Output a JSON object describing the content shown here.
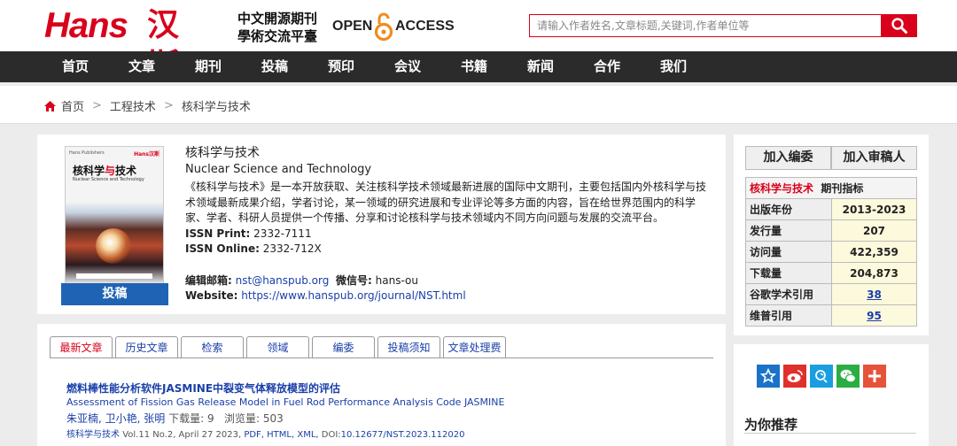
{
  "header": {
    "logo_en": "Hans",
    "logo_cn": "汉斯",
    "tagline_1": "中文開源期刊",
    "tagline_2": "學術交流平臺",
    "oa_open": "OPEN",
    "oa_access": "ACCESS",
    "search_placeholder": "请输入作者姓名,文章标题,关键词,作者单位等"
  },
  "nav": [
    "首页",
    "文章",
    "期刊",
    "投稿",
    "预印",
    "会议",
    "书籍",
    "新闻",
    "合作",
    "我们"
  ],
  "breadcrumb": [
    "首页",
    "工程技术",
    "核科学与技术"
  ],
  "journal": {
    "cover_brand": "Hans Publishers",
    "cover_logo": "Hans汉斯",
    "cover_title_a": "核科学",
    "cover_title_b": "与",
    "cover_title_c": "技术",
    "cover_subtitle": "Nuclear Science and Technology",
    "title_cn": "核科学与技术",
    "title_en": "Nuclear Science and Technology",
    "description": "《核科学与技术》是一本开放获取、关注核科学技术领域最新进展的国际中文期刊，主要包括国内外核科学与技术领域最新成果介绍，学者讨论，某一领域的研究进展和专业评论等多方面的内容，旨在给世界范围内的科学家、学者、科研人员提供一个传播、分享和讨论核科学与技术领域内不同方向问题与发展的交流平台。",
    "issn_print_label": "ISSN Print:",
    "issn_print": "2332-7111",
    "issn_online_label": "ISSN Online:",
    "issn_online": "2332-712X",
    "email_label": "编辑邮箱:",
    "email": "nst@hanspub.org",
    "wechat_label": "微信号:",
    "wechat": "hans-ou",
    "website_label": "Website:",
    "website": "https://www.hanspub.org/journal/NST.html",
    "submit_label": "投稿"
  },
  "right_panel": {
    "join_editor": "加入编委",
    "join_reviewer": "加入审稿人",
    "metrics_journal": "核科学与技术",
    "metrics_title": "期刊指标",
    "rows": [
      {
        "label": "出版年份",
        "value": "2013-2023",
        "link": false
      },
      {
        "label": "发行量",
        "value": "207",
        "link": false
      },
      {
        "label": "访问量",
        "value": "422,359",
        "link": false
      },
      {
        "label": "下载量",
        "value": "204,873",
        "link": false
      },
      {
        "label": "谷歌学术引用",
        "value": "38",
        "link": true
      },
      {
        "label": "维普引用",
        "value": "95",
        "link": true
      }
    ]
  },
  "tabs": [
    "最新文章",
    "历史文章",
    "检索",
    "领域",
    "编委",
    "投稿须知",
    "文章处理费"
  ],
  "article": {
    "title_cn": "燃料棒性能分析软件JASMINE中裂变气体释放模型的评估",
    "title_en": "Assessment of Fission Gas Release Model in Fuel Rod Performance Analysis Code JASMINE",
    "authors": "朱亚楠, 卫小艳, 张明",
    "downloads": "下载量: 9",
    "views": "浏览量: 503",
    "journal": "核科学与技术",
    "volume": "Vol.11 No.2, April 27 2023,",
    "formats": "PDF, HTML, XML,",
    "doi_label": "DOI:",
    "doi": "10.12677/NST.2023.112020"
  },
  "share": {
    "icons": [
      "favorite-star-icon",
      "weibo-icon",
      "qq-icon",
      "wechat-icon",
      "more-plus-icon"
    ],
    "colors": [
      "#1a73c8",
      "#e0302b",
      "#1a9ee0",
      "#2aae43",
      "#e5533a"
    ]
  },
  "recommend_title": "为你推荐",
  "colors": {
    "brand_red": "#d9001b",
    "nav_bg": "#2b2b2b",
    "link_blue": "#1a3fa8",
    "submit_blue": "#1f64b4"
  }
}
